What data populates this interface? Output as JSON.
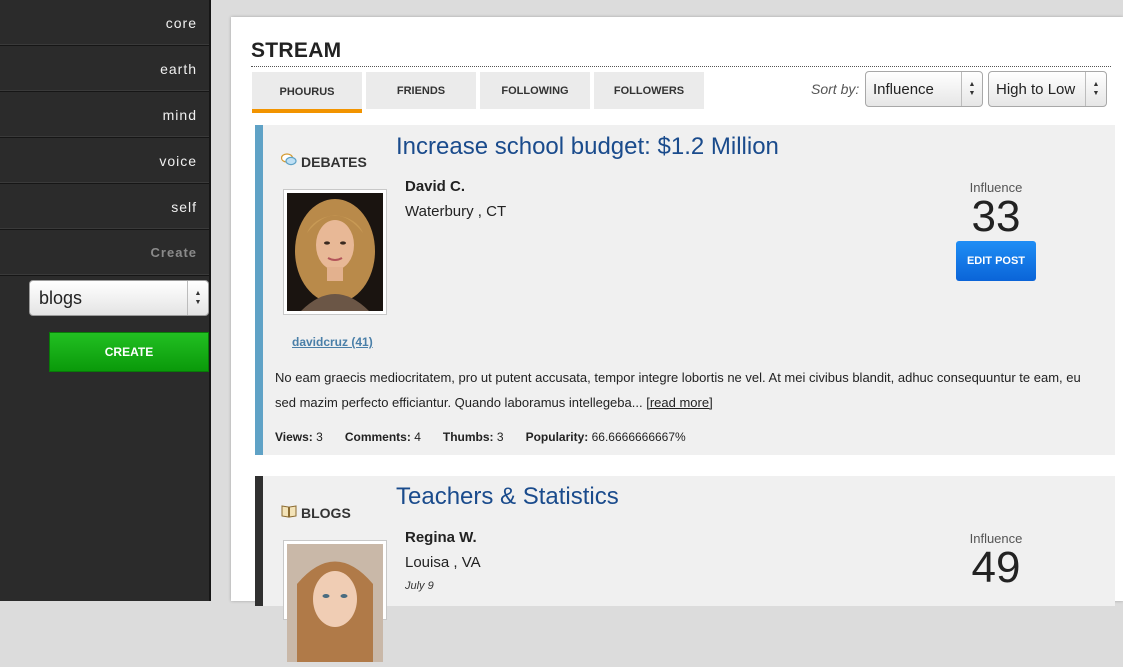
{
  "sidebar": {
    "items": [
      {
        "label": "core"
      },
      {
        "label": "earth"
      },
      {
        "label": "mind"
      },
      {
        "label": "voice"
      },
      {
        "label": "self"
      },
      {
        "label": "Create"
      }
    ],
    "type_select": {
      "value": "blogs"
    },
    "create_label": "CREATE"
  },
  "stream": {
    "title": "STREAM",
    "tabs": [
      {
        "label": "PHOURUS",
        "active": true
      },
      {
        "label": "FRIENDS"
      },
      {
        "label": "FOLLOWING"
      },
      {
        "label": "FOLLOWERS"
      }
    ],
    "sort": {
      "label": "Sort by:",
      "field": "Influence",
      "order": "High to Low"
    }
  },
  "posts": [
    {
      "category": "DEBATES",
      "category_icon": "speech-bubbles-icon",
      "title": "Increase school budget: $1.2 Million",
      "author": "David C.",
      "location": "Waterbury , CT",
      "username": "davidcruz (41)",
      "influence_label": "Influence",
      "influence": "33",
      "edit_label": "EDIT POST",
      "excerpt": "No eam graecis mediocritatem, pro ut putent accusata, tempor integre lobortis ne vel. At mei civibus blandit, adhuc consequuntur te eam, eu sed mazim perfecto efficiantur. Quando laboramus intellegeba...",
      "read_more": "[read more]",
      "stats": [
        {
          "label": "Views:",
          "value": "3"
        },
        {
          "label": "Comments:",
          "value": "4"
        },
        {
          "label": "Thumbs:",
          "value": "3"
        },
        {
          "label": "Popularity:",
          "value": "66.6666666667%"
        }
      ],
      "accent": "#5fa2c6"
    },
    {
      "category": "BLOGS",
      "category_icon": "book-icon",
      "title": "Teachers & Statistics",
      "author": "Regina W.",
      "location": "Louisa , VA",
      "date": "July 9",
      "influence_label": "Influence",
      "influence": "49",
      "accent": "#303030"
    }
  ],
  "colors": {
    "sidebar_bg": "#2b2b2b",
    "tab_active_underline": "#f29400",
    "title_link": "#1a4b8c",
    "create_green": "#11aa11",
    "edit_blue": "#0a78e6"
  }
}
